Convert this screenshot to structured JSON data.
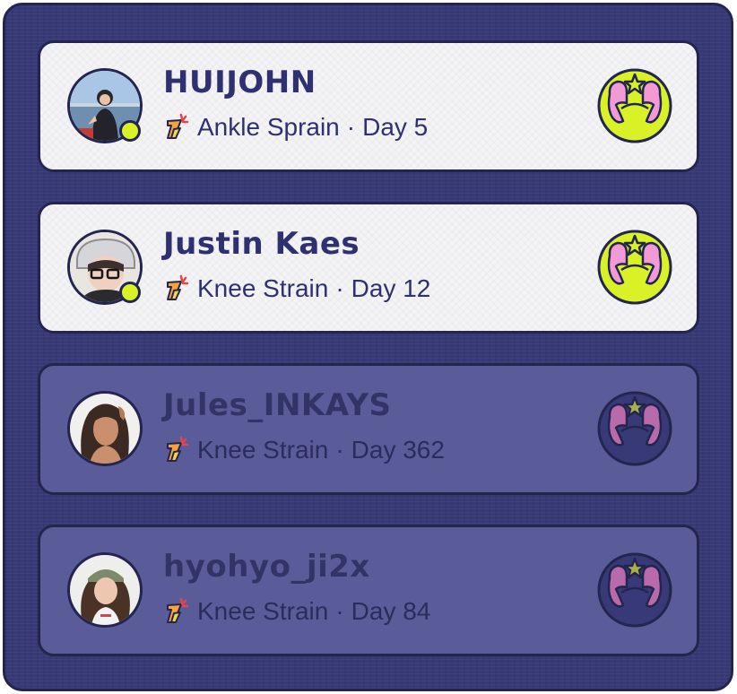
{
  "colors": {
    "panel_bg": "#383a78",
    "card_active_bg": "#f4f4f6",
    "card_inactive_bg": "#5a5c9a",
    "outline": "#23254f",
    "online_dot": "#d8f227",
    "badge_active_bg": "#d8f227",
    "badge_inactive_bg": "#383a78",
    "badge_hands": "#f29ad6"
  },
  "users": [
    {
      "name": "HUIJOHN",
      "injury": "Ankle Sprain",
      "separator": "·",
      "day": "Day 5",
      "online": true,
      "active": true,
      "injury_icon": "injury-icon",
      "badge_icon": "high-five-badge-icon"
    },
    {
      "name": "Justin Kaes",
      "injury": "Knee Strain",
      "separator": "·",
      "day": "Day 12",
      "online": true,
      "active": true,
      "injury_icon": "injury-icon",
      "badge_icon": "high-five-badge-icon"
    },
    {
      "name": "Jules_INKAYS",
      "injury": "Knee Strain",
      "separator": "·",
      "day": "Day 362",
      "online": false,
      "active": false,
      "injury_icon": "injury-icon",
      "badge_icon": "high-five-badge-icon"
    },
    {
      "name": "hyohyo_ji2x",
      "injury": "Knee Strain",
      "separator": "·",
      "day": "Day 84",
      "online": false,
      "active": false,
      "injury_icon": "injury-icon",
      "badge_icon": "high-five-badge-icon"
    }
  ]
}
